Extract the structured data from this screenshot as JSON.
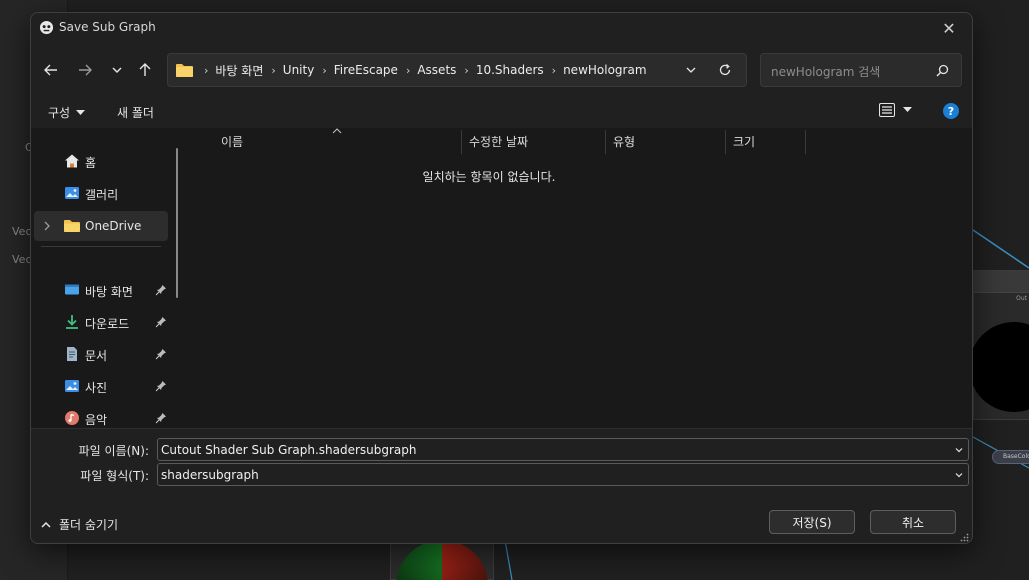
{
  "dialog": {
    "title": "Save Sub Graph",
    "close_glyph": "✕"
  },
  "address": {
    "crumbs": [
      "바탕 화면",
      "Unity",
      "FireEscape",
      "Assets",
      "10.Shaders",
      "newHologram"
    ]
  },
  "search": {
    "placeholder": "newHologram 검색"
  },
  "toolbar": {
    "organize_label": "구성",
    "new_folder_label": "새 폴더",
    "help_glyph": "?"
  },
  "nav": {
    "quick": [
      {
        "label": "홈",
        "icon": "home-icon"
      },
      {
        "label": "갤러리",
        "icon": "gallery-icon"
      },
      {
        "label": "OneDrive",
        "icon": "folder-icon"
      }
    ],
    "pinned": [
      {
        "label": "바탕 화면",
        "icon": "desktop-icon"
      },
      {
        "label": "다운로드",
        "icon": "download-icon"
      },
      {
        "label": "문서",
        "icon": "document-icon"
      },
      {
        "label": "사진",
        "icon": "pictures-icon"
      },
      {
        "label": "음악",
        "icon": "music-icon"
      }
    ]
  },
  "file_list": {
    "columns": [
      "이름",
      "수정한 날짜",
      "유형",
      "크기"
    ],
    "empty_message": "일치하는 항목이 없습니다."
  },
  "form": {
    "filename_label": "파일 이름(N):",
    "filename_value": "Cutout Shader Sub Graph.shadersubgraph",
    "filetype_label": "파일 형식(T):",
    "filetype_value": "shadersubgraph",
    "hide_folders_label": "폴더 숨기기",
    "save_label": "저장(S)",
    "cancel_label": "취소"
  },
  "background": {
    "left_labels": [
      "C",
      "Vec",
      "Vec"
    ],
    "node_out_label": "Out",
    "pill_label": "BaseColor"
  },
  "colors": {
    "accent": "#1b7fd6",
    "folder": "#f2c14e",
    "dialog_bg": "#202020",
    "pane_bg": "#191919"
  }
}
